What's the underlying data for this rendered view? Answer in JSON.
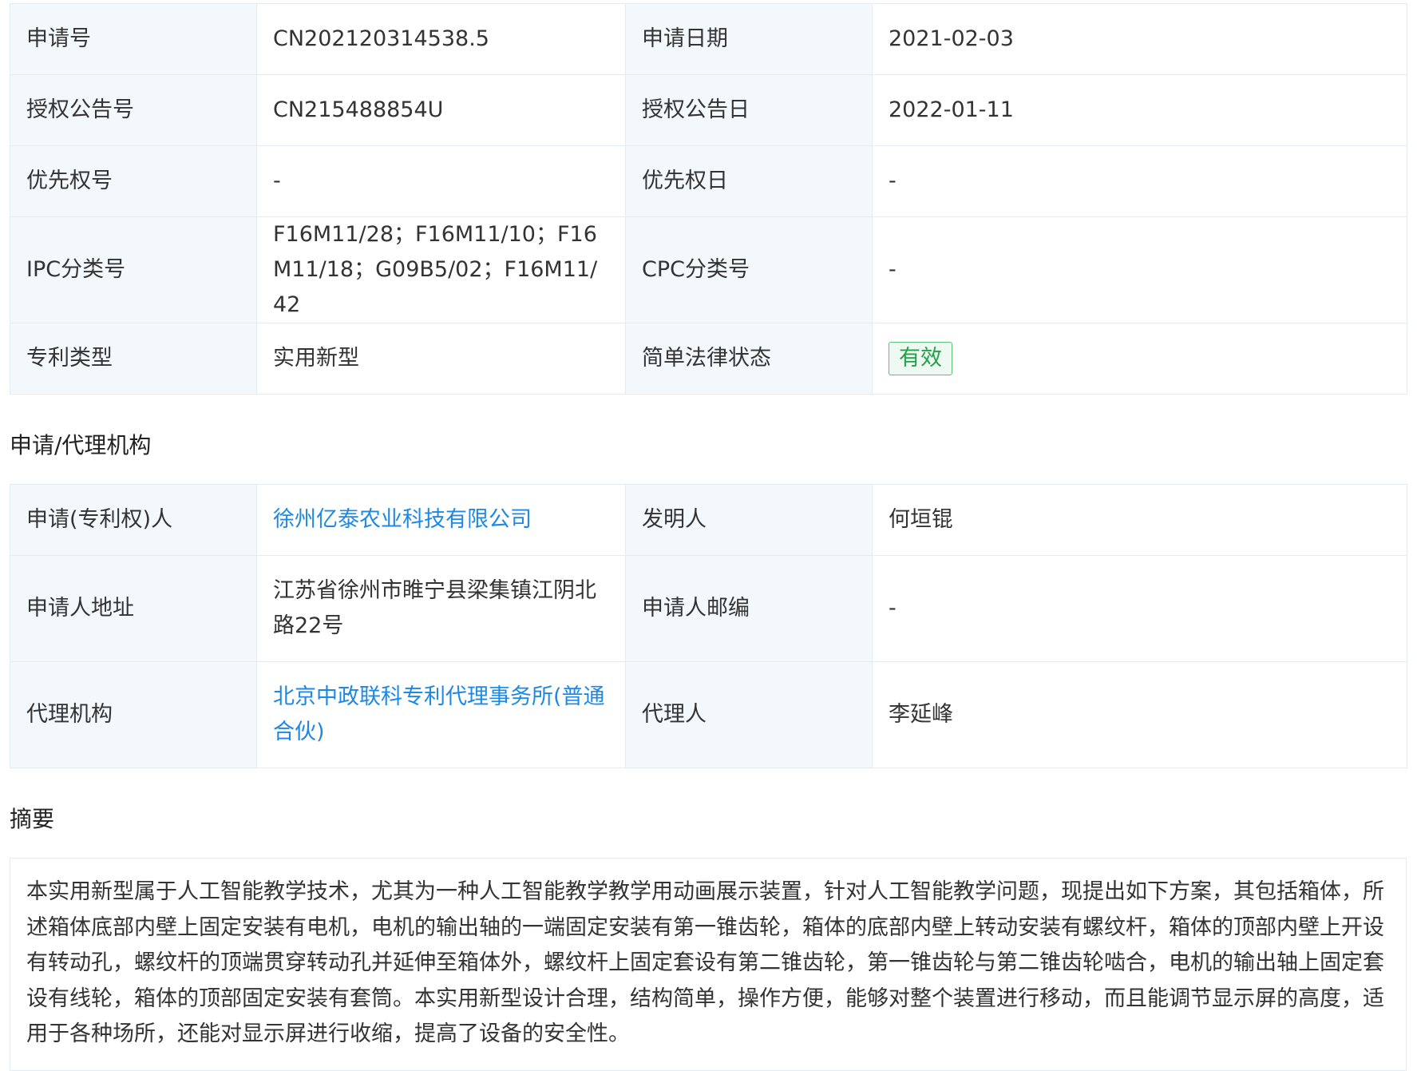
{
  "basic": {
    "rows": [
      {
        "k1": "申请号",
        "v1": "CN202120314538.5",
        "k2": "申请日期",
        "v2": "2021-02-03"
      },
      {
        "k1": "授权公告号",
        "v1": "CN215488854U",
        "k2": "授权公告日",
        "v2": "2022-01-11"
      },
      {
        "k1": "优先权号",
        "v1": "-",
        "k2": "优先权日",
        "v2": "-"
      },
      {
        "k1": "IPC分类号",
        "v1": "F16M11/28；F16M11/10；F16M11/18；G09B5/02；F16M11/42",
        "k2": "CPC分类号",
        "v2": "-"
      },
      {
        "k1": "专利类型",
        "v1": "实用新型",
        "k2": "简单法律状态",
        "v2": "有效"
      }
    ]
  },
  "agency": {
    "title": "申请/代理机构",
    "rows": [
      {
        "k1": "申请(专利权)人",
        "v1": "徐州亿泰农业科技有限公司",
        "k2": "发明人",
        "v2": "何垣锟"
      },
      {
        "k1": "申请人地址",
        "v1": "江苏省徐州市睢宁县梁集镇江阴北路22号",
        "k2": "申请人邮编",
        "v2": "-"
      },
      {
        "k1": "代理机构",
        "v1": "北京中政联科专利代理事务所(普通合伙)",
        "k2": "代理人",
        "v2": "李延峰"
      }
    ]
  },
  "abstract": {
    "title": "摘要",
    "text": "本实用新型属于人工智能教学技术，尤其为一种人工智能教学教学用动画展示装置，针对人工智能教学问题，现提出如下方案，其包括箱体，所述箱体底部内壁上固定安装有电机，电机的输出轴的一端固定安装有第一锥齿轮，箱体的底部内壁上转动安装有螺纹杆，箱体的顶部内壁上开设有转动孔，螺纹杆的顶端贯穿转动孔并延伸至箱体外，螺纹杆上固定套设有第二锥齿轮，第一锥齿轮与第二锥齿轮啮合，电机的输出轴上固定套设有线轮，箱体的顶部固定安装有套筒。本实用新型设计合理，结构简单，操作方便，能够对整个装置进行移动，而且能调节显示屏的高度，适用于各种场所，还能对显示屏进行收缩，提高了设备的安全性。"
  },
  "colors": {
    "label_bg": "#f3f8fc",
    "border": "#e4ecf3",
    "link": "#1e88e5",
    "status_green": "#22a149"
  }
}
